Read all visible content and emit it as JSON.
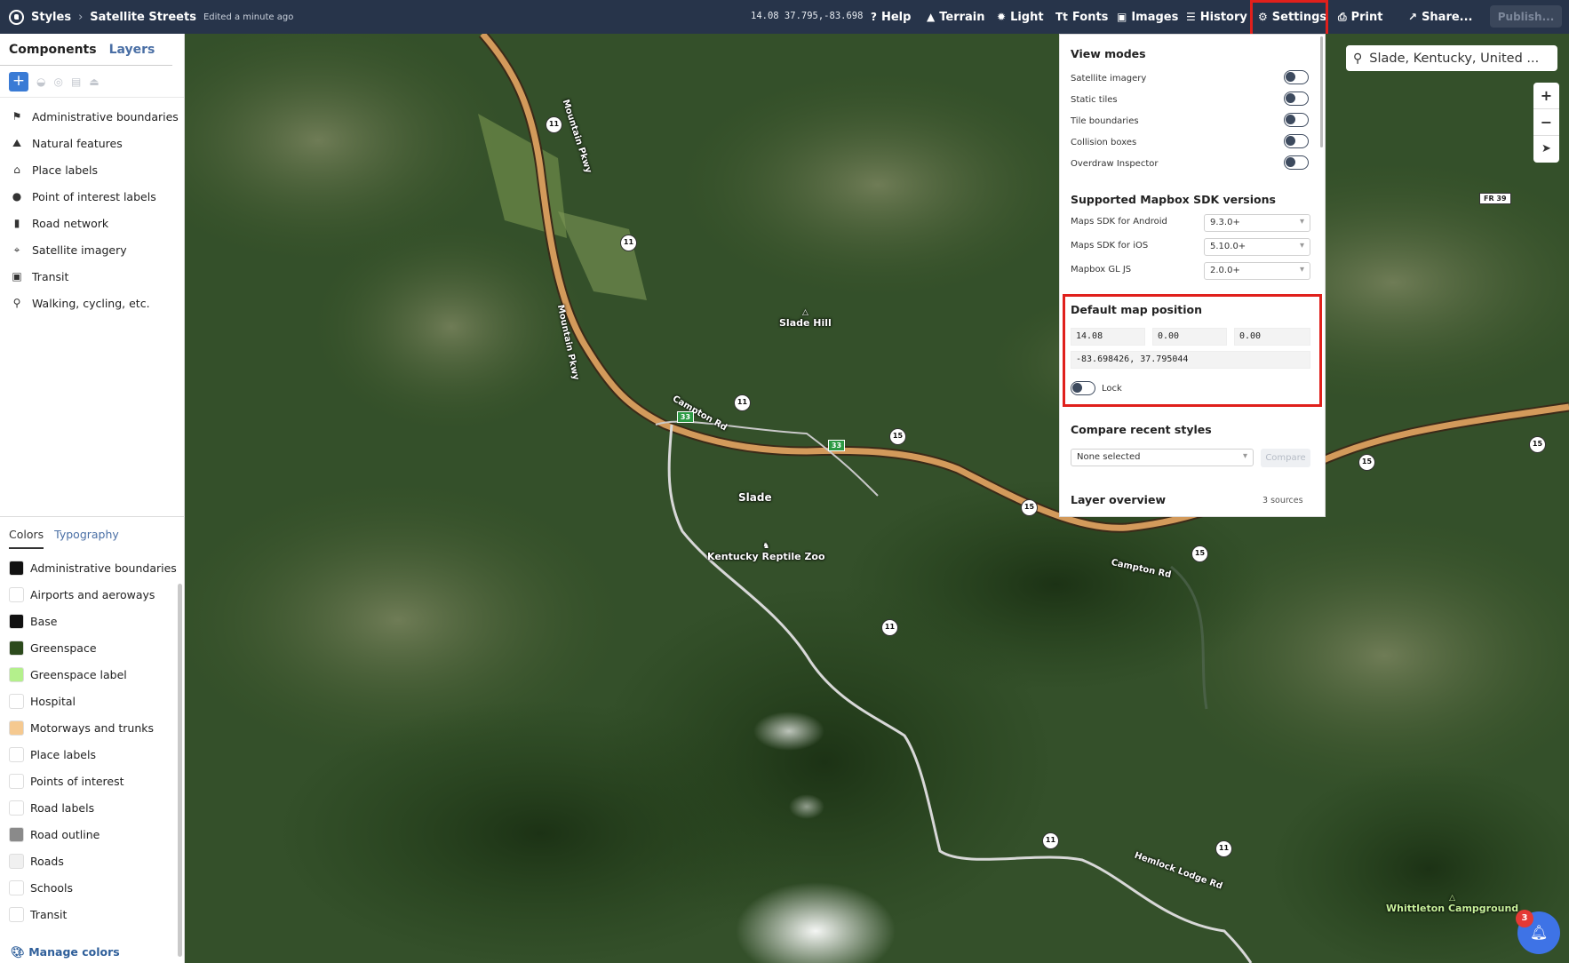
{
  "header": {
    "brand": "Styles",
    "style_name": "Satellite Streets",
    "edited": "Edited a minute ago",
    "coords": "14.08 37.795,-83.698",
    "nav": [
      {
        "label": "Help",
        "icon": "help-icon"
      },
      {
        "label": "Terrain",
        "icon": "terrain-icon"
      },
      {
        "label": "Light",
        "icon": "light-icon"
      },
      {
        "label": "Fonts",
        "icon": "fonts-icon"
      },
      {
        "label": "Images",
        "icon": "images-icon"
      },
      {
        "label": "History",
        "icon": "history-icon"
      },
      {
        "label": "Settings",
        "icon": "gear-icon"
      },
      {
        "label": "Print",
        "icon": "print-icon"
      },
      {
        "label": "Share...",
        "icon": "share-icon"
      }
    ],
    "publish": "Publish..."
  },
  "sidebar": {
    "tabs": [
      "Components",
      "Layers"
    ],
    "components": [
      "Administrative boundaries",
      "Natural features",
      "Place labels",
      "Point of interest labels",
      "Road network",
      "Satellite imagery",
      "Transit",
      "Walking, cycling, etc."
    ],
    "color_tabs": [
      "Colors",
      "Typography"
    ],
    "colors": [
      {
        "name": "Administrative boundaries",
        "color": "#111111"
      },
      {
        "name": "Airports and aeroways",
        "color": "#ffffff"
      },
      {
        "name": "Base",
        "color": "#111111"
      },
      {
        "name": "Greenspace",
        "color": "#2c4a1c"
      },
      {
        "name": "Greenspace label",
        "color": "#b4f08c"
      },
      {
        "name": "Hospital",
        "color": "#ffffff"
      },
      {
        "name": "Motorways and trunks",
        "color": "#f5c990"
      },
      {
        "name": "Place labels",
        "color": "#ffffff"
      },
      {
        "name": "Points of interest",
        "color": "#ffffff"
      },
      {
        "name": "Road labels",
        "color": "#ffffff"
      },
      {
        "name": "Road outline",
        "color": "#8a8a8a"
      },
      {
        "name": "Roads",
        "color": "#f0f0f0"
      },
      {
        "name": "Schools",
        "color": "#ffffff"
      },
      {
        "name": "Transit",
        "color": "#ffffff"
      }
    ],
    "manage_colors": "Manage colors"
  },
  "settings_panel": {
    "view_modes_title": "View modes",
    "view_modes": [
      "Satellite imagery",
      "Static tiles",
      "Tile boundaries",
      "Collision boxes",
      "Overdraw Inspector"
    ],
    "sdk_title": "Supported Mapbox SDK versions",
    "sdk": [
      {
        "label": "Maps SDK for Android",
        "value": "9.3.0+"
      },
      {
        "label": "Maps SDK for iOS",
        "value": "5.10.0+"
      },
      {
        "label": "Mapbox GL JS",
        "value": "2.0.0+"
      }
    ],
    "position_title": "Default map position",
    "zoom": "14.08",
    "bearing": "0.00",
    "pitch": "0.00",
    "center": "-83.698426, 37.795044",
    "lock_label": "Lock",
    "compare_title": "Compare recent styles",
    "compare_select": "None selected",
    "compare_button": "Compare",
    "layer_overview": "Layer overview",
    "sources": "3 sources"
  },
  "map": {
    "search": "Slade, Kentucky, United ...",
    "labels": [
      "Slade Hill",
      "Slade",
      "Kentucky Reptile Zoo",
      "Whittleton Campground"
    ],
    "roads": [
      "Mountain Pkwy",
      "Mountain Pkwy",
      "Campton Rd",
      "Campton Rd",
      "Hemlock Lodge Rd"
    ],
    "fr": "FR 39",
    "notifications": "3"
  }
}
